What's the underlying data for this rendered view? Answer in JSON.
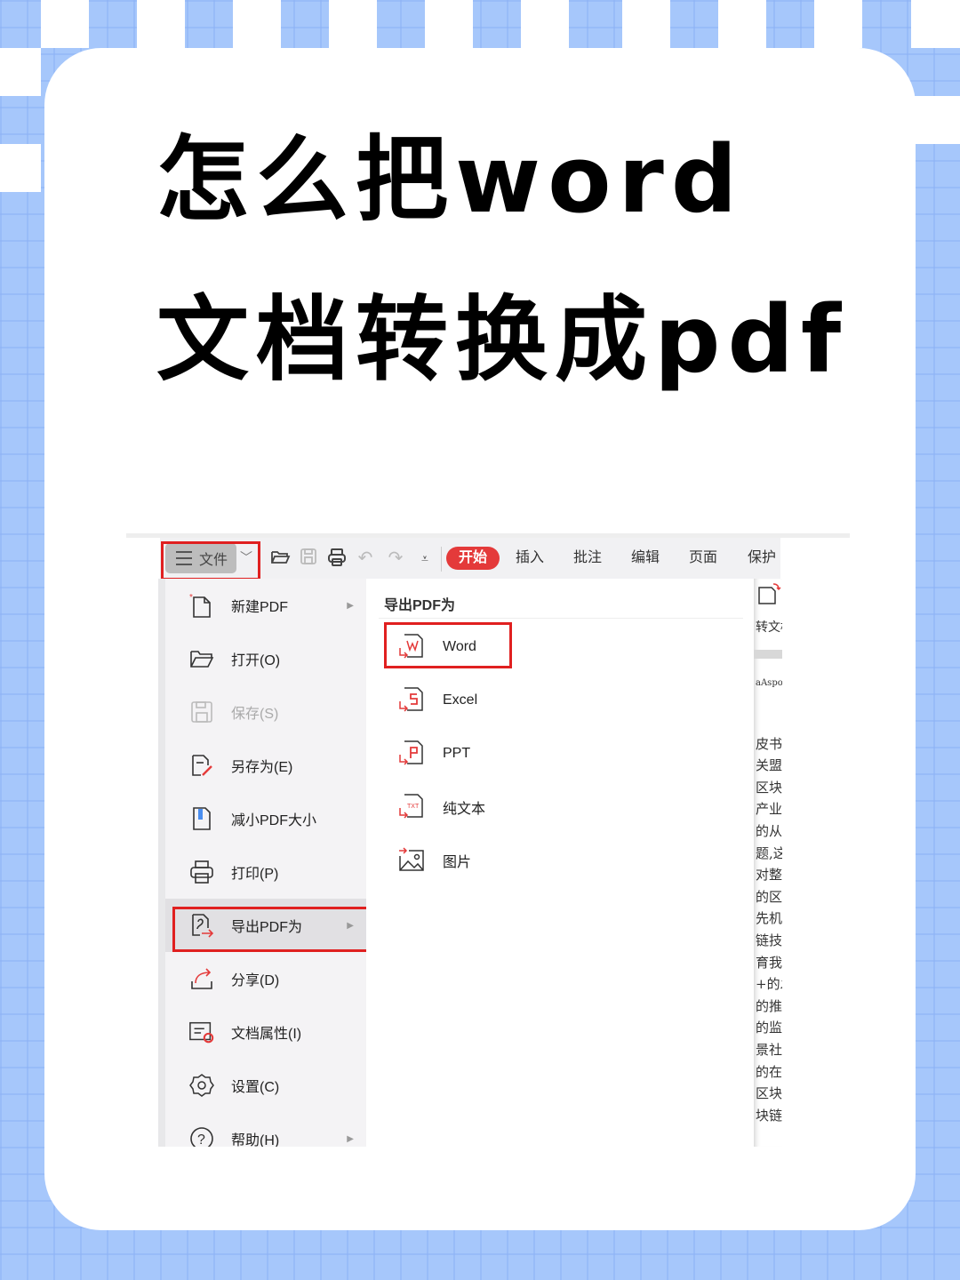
{
  "title": {
    "line1": "怎么把word",
    "line2": "文档转换成pdf"
  },
  "toolbar": {
    "file_label": "文件",
    "icons": [
      "menu-icon",
      "chevron-down-icon",
      "open-folder-icon",
      "save-icon",
      "print-icon",
      "undo-icon",
      "redo-icon",
      "customize-icon"
    ],
    "tabs": [
      {
        "label": "开始",
        "active": true
      },
      {
        "label": "插入",
        "active": false
      },
      {
        "label": "批注",
        "active": false
      },
      {
        "label": "编辑",
        "active": false
      },
      {
        "label": "页面",
        "active": false
      },
      {
        "label": "保护",
        "active": false
      }
    ]
  },
  "file_menu": {
    "items": [
      {
        "label": "新建PDF",
        "icon": "new-pdf-icon",
        "submenu": true,
        "disabled": false
      },
      {
        "label": "打开(O)",
        "icon": "open-folder-icon",
        "submenu": false,
        "disabled": false
      },
      {
        "label": "保存(S)",
        "icon": "save-icon",
        "submenu": false,
        "disabled": true
      },
      {
        "label": "另存为(E)",
        "icon": "save-as-icon",
        "submenu": false,
        "disabled": false
      },
      {
        "label": "减小PDF大小",
        "icon": "compress-icon",
        "submenu": false,
        "disabled": false
      },
      {
        "label": "打印(P)",
        "icon": "print-icon",
        "submenu": false,
        "disabled": false
      },
      {
        "label": "导出PDF为",
        "icon": "export-icon",
        "submenu": true,
        "disabled": false,
        "highlighted": true
      },
      {
        "label": "分享(D)",
        "icon": "share-icon",
        "submenu": false,
        "disabled": false
      },
      {
        "label": "文档属性(I)",
        "icon": "document-properties-icon",
        "submenu": false,
        "disabled": false
      },
      {
        "label": "设置(C)",
        "icon": "settings-icon",
        "submenu": false,
        "disabled": false
      },
      {
        "label": "帮助(H)",
        "icon": "help-icon",
        "submenu": true,
        "disabled": false
      }
    ]
  },
  "export_submenu": {
    "heading": "导出PDF为",
    "items": [
      {
        "label": "Word",
        "icon": "word-export-icon",
        "glyph": "W",
        "highlighted": true
      },
      {
        "label": "Excel",
        "icon": "excel-export-icon",
        "glyph": "S"
      },
      {
        "label": "PPT",
        "icon": "ppt-export-icon",
        "glyph": "P"
      },
      {
        "label": "纯文本",
        "icon": "txt-export-icon",
        "glyph": "TXT"
      },
      {
        "label": "图片",
        "icon": "image-export-icon",
        "glyph": ""
      }
    ]
  },
  "document_peek": {
    "ribbon_label": "转文档",
    "lines": [
      "aAspo",
      "",
      "皮书",
      "关盟力",
      "区块链",
      "产业",
      "的从企",
      "题,这",
      "对整",
      "的区块",
      "先机",
      "链技",
      "育我国",
      "+的发",
      "的推",
      "的监",
      "景社",
      "的在参",
      "区块",
      "块链"
    ]
  },
  "colors": {
    "accent_red": "#e43a3a",
    "highlight_box": "#e02020",
    "background_blue": "#a6c7fb"
  }
}
